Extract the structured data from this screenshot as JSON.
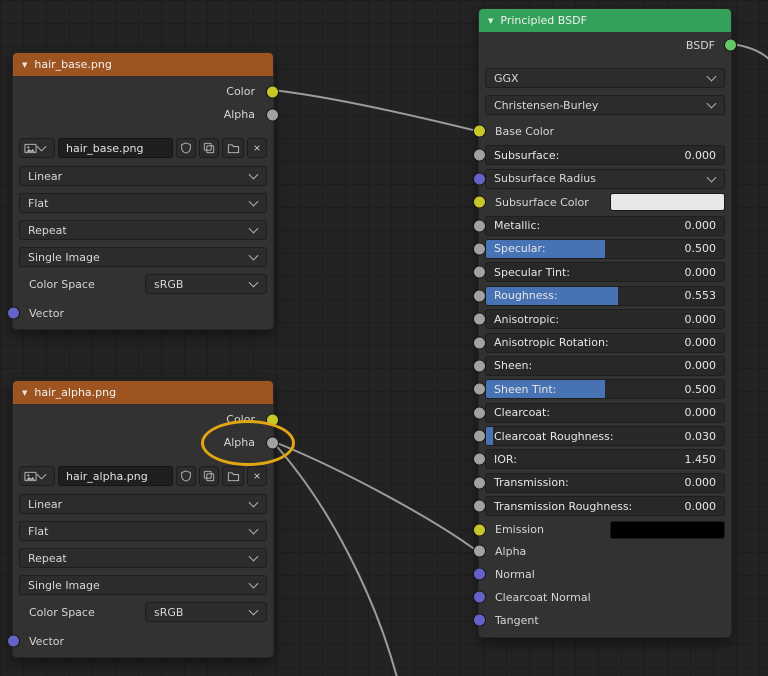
{
  "colors": {
    "accent_blue": "#4772b3",
    "socket_yellow": "#c7c729",
    "socket_gray": "#a1a1a1",
    "socket_vector": "#6363c7",
    "socket_shader": "#63c763",
    "header_texture": "#9e5420",
    "header_shader": "#33a159",
    "wire": "#9c9c9c",
    "annotation_yellow": "#e0a712",
    "subsurface_color_swatch": "#e8e8e8",
    "emission_swatch": "#000000"
  },
  "hair_base": {
    "title": "hair_base.png",
    "color_output": "Color",
    "alpha_output": "Alpha",
    "image_name": "hair_base.png",
    "interpolation": "Linear",
    "projection": "Flat",
    "extension": "Repeat",
    "source": "Single Image",
    "color_space_label": "Color Space",
    "color_space_value": "sRGB",
    "vector_input": "Vector"
  },
  "hair_alpha": {
    "title": "hair_alpha.png",
    "color_output": "Color",
    "alpha_output": "Alpha",
    "image_name": "hair_alpha.png",
    "interpolation": "Linear",
    "projection": "Flat",
    "extension": "Repeat",
    "source": "Single Image",
    "color_space_label": "Color Space",
    "color_space_value": "sRGB",
    "vector_input": "Vector"
  },
  "bsdf": {
    "title": "Principled BSDF",
    "output_label": "BSDF",
    "distribution": "GGX",
    "subsurface_method": "Christensen-Burley",
    "base_color": "Base Color",
    "subsurface": {
      "label": "Subsurface:",
      "value": "0.000",
      "fill_style": "width:0%"
    },
    "subsurface_radius": "Subsurface Radius",
    "subsurface_color": "Subsurface Color",
    "metallic": {
      "label": "Metallic:",
      "value": "0.000",
      "fill_style": "width:0%"
    },
    "specular": {
      "label": "Specular:",
      "value": "0.500",
      "fill_style": "width:50%"
    },
    "specular_tint": {
      "label": "Specular Tint:",
      "value": "0.000",
      "fill_style": "width:0%"
    },
    "roughness": {
      "label": "Roughness:",
      "value": "0.553",
      "fill_style": "width:55.3%"
    },
    "anisotropic": {
      "label": "Anisotropic:",
      "value": "0.000",
      "fill_style": "width:0%"
    },
    "anisotropic_rotation": {
      "label": "Anisotropic Rotation:",
      "value": "0.000",
      "fill_style": "width:0%"
    },
    "sheen": {
      "label": "Sheen:",
      "value": "0.000",
      "fill_style": "width:0%"
    },
    "sheen_tint": {
      "label": "Sheen Tint:",
      "value": "0.500",
      "fill_style": "width:50%"
    },
    "clearcoat": {
      "label": "Clearcoat:",
      "value": "0.000",
      "fill_style": "width:0%"
    },
    "clearcoat_roughness": {
      "label": "Clearcoat Roughness:",
      "value": "0.030",
      "fill_style": "width:3%"
    },
    "ior": {
      "label": "IOR:",
      "value": "1.450",
      "fill_style": "width:0%"
    },
    "transmission": {
      "label": "Transmission:",
      "value": "0.000",
      "fill_style": "width:0%"
    },
    "transmission_roughness": {
      "label": "Transmission Roughness:",
      "value": "0.000",
      "fill_style": "width:0%"
    },
    "emission": "Emission",
    "alpha": "Alpha",
    "normal": "Normal",
    "clearcoat_normal": "Clearcoat Normal",
    "tangent": "Tangent"
  }
}
